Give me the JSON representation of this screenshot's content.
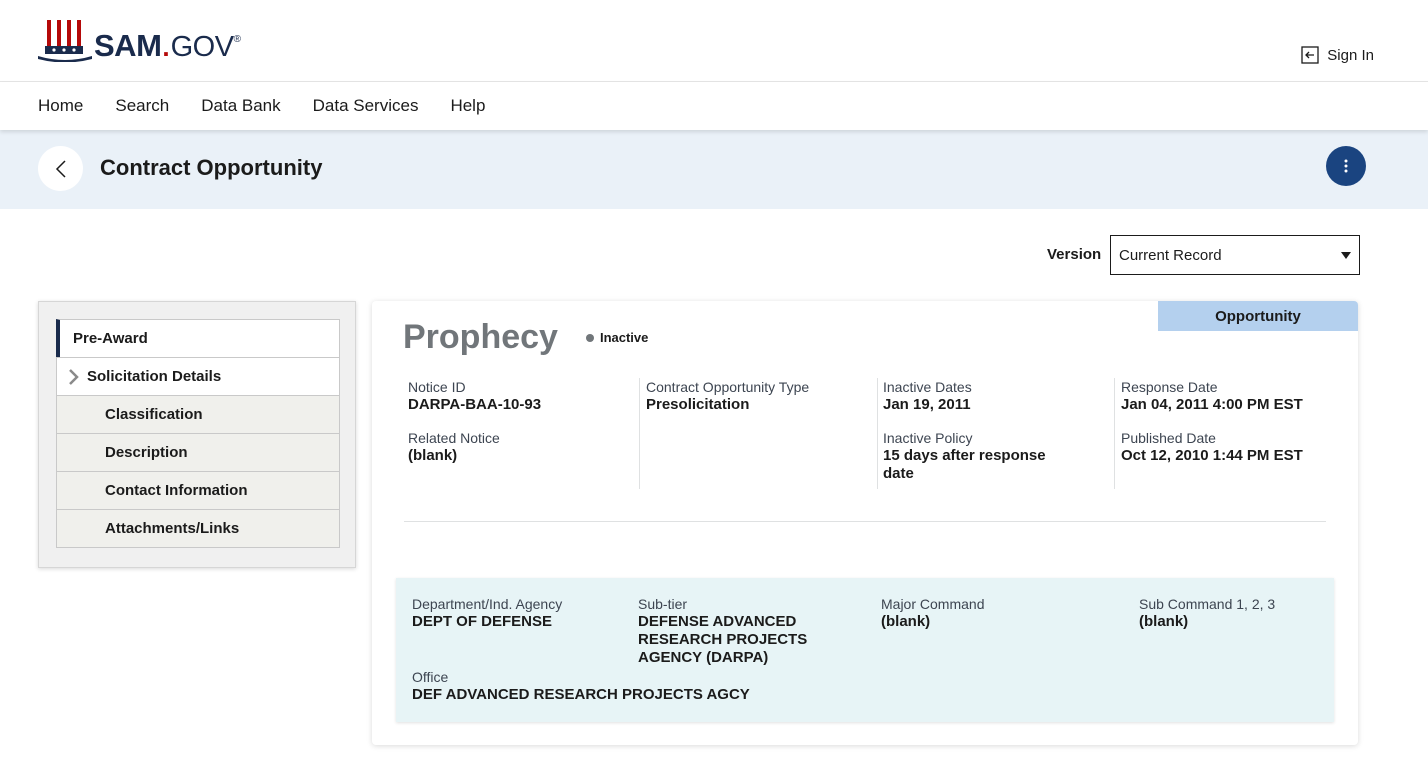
{
  "header": {
    "logo_sam": "SAM",
    "logo_gov": "GOV",
    "logo_reg": "®",
    "signin_label": "Sign In"
  },
  "nav": {
    "items": [
      "Home",
      "Search",
      "Data Bank",
      "Data Services",
      "Help"
    ]
  },
  "page": {
    "title": "Contract Opportunity"
  },
  "version": {
    "label": "Version",
    "selected": "Current Record"
  },
  "sidebar": {
    "items": [
      {
        "label": "Pre-Award"
      },
      {
        "label": "Solicitation Details"
      },
      {
        "label": "Classification"
      },
      {
        "label": "Description"
      },
      {
        "label": "Contact Information"
      },
      {
        "label": "Attachments/Links"
      }
    ]
  },
  "opportunity": {
    "tab_label": "Opportunity",
    "title": "Prophecy",
    "status": "Inactive",
    "fields": {
      "notice_id": {
        "label": "Notice ID",
        "value": "DARPA-BAA-10-93"
      },
      "related_notice": {
        "label": "Related Notice",
        "value": "(blank)"
      },
      "type": {
        "label": "Contract Opportunity Type",
        "value": "Presolicitation"
      },
      "inactive_dates": {
        "label": "Inactive Dates",
        "value": "Jan 19, 2011"
      },
      "inactive_policy": {
        "label": "Inactive Policy",
        "value": "15 days after response date"
      },
      "response_date": {
        "label": "Response Date",
        "value": "Jan 04, 2011 4:00 PM EST"
      },
      "published_date": {
        "label": "Published Date",
        "value": "Oct 12, 2010 1:44 PM EST"
      }
    }
  },
  "agency": {
    "department": {
      "label": "Department/Ind. Agency",
      "value": "DEPT OF DEFENSE"
    },
    "subtier": {
      "label": "Sub-tier",
      "value": "DEFENSE ADVANCED RESEARCH PROJECTS AGENCY (DARPA)"
    },
    "major_command": {
      "label": "Major Command",
      "value": "(blank)"
    },
    "sub_command": {
      "label": "Sub Command 1, 2, 3",
      "value": "(blank)"
    },
    "office": {
      "label": "Office",
      "value": "DEF ADVANCED RESEARCH PROJECTS AGCY"
    }
  },
  "colors": {
    "brand_navy": "#1a2b4c",
    "brand_red": "#b50909",
    "accent_blue": "#1a4480",
    "title_band": "#eaf1f8",
    "agency_bg": "#e7f4f6",
    "opportunity_tab": "#b4d0ee"
  },
  "icons": {
    "logo": "uncle-sam-hat-icon",
    "signin": "sign-in-icon",
    "back": "chevron-left-icon",
    "more": "more-vertical-icon",
    "dropdown": "caret-down-icon",
    "expand": "chevron-right-icon"
  }
}
